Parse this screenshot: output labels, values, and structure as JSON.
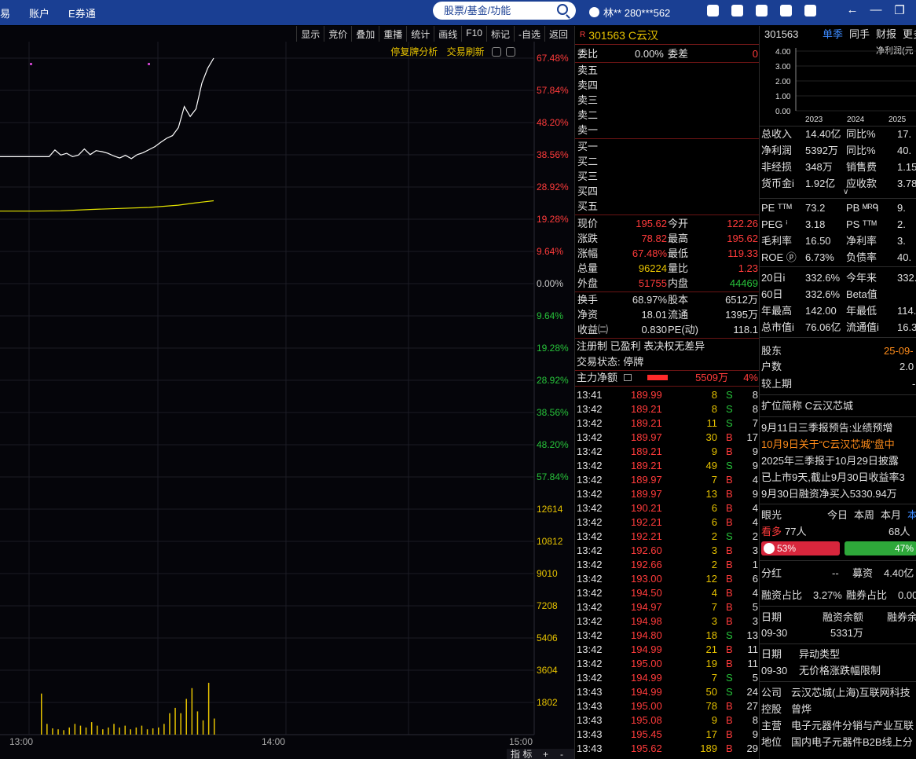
{
  "topbar": {
    "menu": [
      "易",
      "账户",
      "E券通"
    ],
    "search_placeholder": "股票/基金/功能",
    "user": "林**  280***562"
  },
  "chart": {
    "toolbar": [
      "显示",
      "竞价",
      "叠加",
      "重播",
      "统计",
      "画线",
      "F10",
      "标记",
      "-自选",
      "返回"
    ],
    "links": [
      "停复牌分析",
      "交易刷新"
    ],
    "pct_axis": [
      "67.48%",
      "57.84%",
      "48.20%",
      "38.56%",
      "28.92%",
      "19.28%",
      "9.64%",
      "0.00%",
      "9.64%",
      "19.28%",
      "28.92%",
      "38.56%",
      "48.20%",
      "57.84%"
    ],
    "vol_axis": [
      "12614",
      "10812",
      "9010",
      "7208",
      "5406",
      "3604",
      "1802"
    ],
    "time_axis": [
      "13:00",
      "14:00",
      "15:00"
    ],
    "bottom_tabs": [
      "指 标",
      "+",
      "-"
    ]
  },
  "quote": {
    "code": "301563 C云汉",
    "weibi": {
      "label": "委比",
      "value": "0.00%",
      "label2": "委差",
      "value2": "0"
    },
    "asks": [
      "卖五",
      "卖四",
      "卖三",
      "卖二",
      "卖一"
    ],
    "bids": [
      "买一",
      "买二",
      "买三",
      "买四",
      "买五"
    ],
    "stats": [
      {
        "l1": "现价",
        "v1": "195.62",
        "c1": "red",
        "l2": "今开",
        "v2": "122.26",
        "c2": "red"
      },
      {
        "l1": "涨跌",
        "v1": "78.82",
        "c1": "red",
        "l2": "最高",
        "v2": "195.62",
        "c2": "red"
      },
      {
        "l1": "涨幅",
        "v1": "67.48%",
        "c1": "red",
        "l2": "最低",
        "v2": "119.33",
        "c2": "red"
      },
      {
        "l1": "总量",
        "v1": "96224",
        "c1": "yellow",
        "l2": "量比",
        "v2": "1.23",
        "c2": "red"
      },
      {
        "l1": "外盘",
        "v1": "51755",
        "c1": "red",
        "l2": "内盘",
        "v2": "44469",
        "c2": "green"
      }
    ],
    "stats2": [
      {
        "l1": "换手",
        "v1": "68.97%",
        "l2": "股本",
        "v2": "6512万"
      },
      {
        "l1": "净资",
        "v1": "18.01",
        "l2": "流通",
        "v2": "1395万"
      },
      {
        "l1": "收益㈡",
        "v1": "0.830",
        "l2": "PE(动)",
        "v2": "118.1"
      }
    ],
    "tags": "注册制 已盈利 表决权无差异",
    "status": "交易状态: 停牌",
    "main_flow": {
      "label": "主力净额",
      "value": "5509万",
      "pct": "4%"
    },
    "ticks": [
      {
        "t": "13:41",
        "p": "189.99",
        "v": "8",
        "d": "S",
        "n": "8"
      },
      {
        "t": "13:42",
        "p": "189.21",
        "v": "8",
        "d": "S",
        "n": "8"
      },
      {
        "t": "13:42",
        "p": "189.21",
        "v": "11",
        "d": "S",
        "n": "7"
      },
      {
        "t": "13:42",
        "p": "189.97",
        "v": "30",
        "d": "B",
        "n": "17"
      },
      {
        "t": "13:42",
        "p": "189.21",
        "v": "9",
        "d": "B",
        "n": "9"
      },
      {
        "t": "13:42",
        "p": "189.21",
        "v": "49",
        "d": "S",
        "n": "9"
      },
      {
        "t": "13:42",
        "p": "189.97",
        "v": "7",
        "d": "B",
        "n": "4"
      },
      {
        "t": "13:42",
        "p": "189.97",
        "v": "13",
        "d": "B",
        "n": "9"
      },
      {
        "t": "13:42",
        "p": "190.21",
        "v": "6",
        "d": "B",
        "n": "4"
      },
      {
        "t": "13:42",
        "p": "192.21",
        "v": "6",
        "d": "B",
        "n": "4"
      },
      {
        "t": "13:42",
        "p": "192.21",
        "v": "2",
        "d": "S",
        "n": "2"
      },
      {
        "t": "13:42",
        "p": "192.60",
        "v": "3",
        "d": "B",
        "n": "3"
      },
      {
        "t": "13:42",
        "p": "192.66",
        "v": "2",
        "d": "B",
        "n": "1"
      },
      {
        "t": "13:42",
        "p": "193.00",
        "v": "12",
        "d": "B",
        "n": "6"
      },
      {
        "t": "13:42",
        "p": "194.50",
        "v": "4",
        "d": "B",
        "n": "4"
      },
      {
        "t": "13:42",
        "p": "194.97",
        "v": "7",
        "d": "B",
        "n": "5"
      },
      {
        "t": "13:42",
        "p": "194.98",
        "v": "3",
        "d": "B",
        "n": "3"
      },
      {
        "t": "13:42",
        "p": "194.80",
        "v": "18",
        "d": "S",
        "n": "13"
      },
      {
        "t": "13:42",
        "p": "194.99",
        "v": "21",
        "d": "B",
        "n": "11"
      },
      {
        "t": "13:42",
        "p": "195.00",
        "v": "19",
        "d": "B",
        "n": "11"
      },
      {
        "t": "13:42",
        "p": "194.99",
        "v": "7",
        "d": "S",
        "n": "5"
      },
      {
        "t": "13:43",
        "p": "194.99",
        "v": "50",
        "d": "S",
        "n": "24"
      },
      {
        "t": "13:43",
        "p": "195.00",
        "v": "78",
        "d": "B",
        "n": "27"
      },
      {
        "t": "13:43",
        "p": "195.08",
        "v": "9",
        "d": "B",
        "n": "8"
      },
      {
        "t": "13:43",
        "p": "195.45",
        "v": "17",
        "d": "B",
        "n": "9"
      },
      {
        "t": "13:43",
        "p": "195.62",
        "v": "189",
        "d": "B",
        "n": "29"
      }
    ]
  },
  "info": {
    "code": "301563",
    "tabs": [
      "单季",
      "同手",
      "财报",
      "更多"
    ],
    "chart_title": "净利润(元",
    "chart_y": [
      "4.00",
      "3.00",
      "2.00",
      "1.00",
      "0.00"
    ],
    "chart_x": [
      "2023",
      "2024",
      "2025"
    ],
    "fin": [
      {
        "l1": "总收入",
        "v1": "14.40亿",
        "l2": "同比%",
        "v2": "17."
      },
      {
        "l1": "净利润",
        "v1": "5392万",
        "l2": "同比%",
        "v2": "40."
      },
      {
        "l1": "非经损",
        "v1": "348万",
        "l2": "销售费",
        "v2": "1.15"
      },
      {
        "l1": "货币金i",
        "v1": "1.92亿",
        "l2": "应收款",
        "v2": "3.78"
      }
    ],
    "val": [
      {
        "l1": "PE ᵀᵀᴹ",
        "v1": "73.2",
        "l2": "PB ᴹᴿᑫ",
        "v2": "9."
      },
      {
        "l1": "PEG ⁱ",
        "v1": "3.18",
        "l2": "PS ᵀᵀᴹ",
        "v2": "2."
      },
      {
        "l1": "毛利率",
        "v1": "16.50",
        "l2": "净利率",
        "v2": "3."
      },
      {
        "l1": "ROE ⓟ",
        "v1": "6.73%",
        "l2": "负债率",
        "v2": "40."
      }
    ],
    "perf": [
      {
        "l1": "20日i",
        "v1": "332.6%",
        "l2": "今年来",
        "v2": "332.6"
      },
      {
        "l1": "60日",
        "v1": "332.6%",
        "l2": "Beta值",
        "v2": ""
      },
      {
        "l1": "年最高",
        "v1": "142.00",
        "l2": "年最低",
        "v2": "114."
      },
      {
        "l1": "总市值i",
        "v1": "76.06亿",
        "l2": "流通值i",
        "v2": "16.30"
      }
    ],
    "holders": {
      "label": "股东",
      "date": "25-09-",
      "count_label": "户数",
      "count": "2.0",
      "prev_label": "较上期",
      "prev": "-"
    },
    "short_name": "扩位简称  C云汉芯城",
    "news": [
      {
        "text": "9月11日三季报预告:业绩预增",
        "color": "white"
      },
      {
        "text": "10月9日关于“C云汉芯城”盘中",
        "color": "orange"
      },
      {
        "text": "2025年三季报于10月29日披露",
        "color": "white"
      },
      {
        "text": "已上市9天,截止9月30日收益率3",
        "color": "white"
      },
      {
        "text": "9月30日融资净买入5330.94万",
        "color": "white"
      }
    ],
    "vision": {
      "label": "眼光",
      "tabs": [
        "今日",
        "本周",
        "本月",
        "本"
      ],
      "bull_label": "看多",
      "bull_count": "77人",
      "bear_count": "68人",
      "bull_pct": "53%",
      "bear_pct": "47%",
      "bull_frac": 0.53
    },
    "dividend": {
      "l1": "分红",
      "v1": "--",
      "l2": "募资",
      "v2": "4.40亿"
    },
    "margin": {
      "l1": "融资占比",
      "v1": "3.27%",
      "l2": "融券占比",
      "v2": "0.00"
    },
    "margin_table": {
      "h1": "日期",
      "h2": "融资余额",
      "h3": "融券余",
      "d": "09-30",
      "v": "5331万"
    },
    "anomaly": {
      "h1": "日期",
      "h2": "异动类型",
      "d": "09-30",
      "v": "无价格涨跌幅限制"
    },
    "company": [
      {
        "l": "公司",
        "v": "云汉芯城(上海)互联网科技"
      },
      {
        "l": "控股",
        "v": "曾烨"
      },
      {
        "l": "主营",
        "v": "电子元器件分销与产业互联"
      },
      {
        "l": "地位",
        "v": "国内电子元器件B2B线上分"
      }
    ]
  },
  "chart_data": {
    "type": "line",
    "x_range": [
      "13:00",
      "15:00"
    ],
    "pct_range": [
      -57.84,
      67.48
    ],
    "price_pct_series": [
      [
        0,
        38.0
      ],
      [
        3,
        38.0
      ],
      [
        4,
        40.0
      ],
      [
        5,
        38.5
      ],
      [
        6,
        39.0
      ],
      [
        7,
        38.0
      ],
      [
        8,
        38.5
      ],
      [
        9,
        40.3
      ],
      [
        10,
        38.6
      ],
      [
        11,
        39.8
      ],
      [
        12,
        39.5
      ],
      [
        13,
        39.0
      ],
      [
        14,
        38.2
      ],
      [
        15,
        37.6
      ],
      [
        16,
        38.4
      ],
      [
        17,
        37.4
      ],
      [
        18,
        38.6
      ],
      [
        19,
        39.2
      ],
      [
        20,
        40.1
      ],
      [
        21,
        41.0
      ],
      [
        22,
        42.3
      ],
      [
        23,
        43.5
      ],
      [
        24,
        44.3
      ],
      [
        25,
        46.7
      ],
      [
        26,
        53.0
      ],
      [
        27,
        50.0
      ],
      [
        28,
        52.3
      ],
      [
        29,
        60.0
      ],
      [
        30,
        64.5
      ],
      [
        31,
        67.48
      ]
    ],
    "avg_pct_series": [
      [
        0,
        21.7
      ],
      [
        5,
        21.8
      ],
      [
        10,
        22.2
      ],
      [
        15,
        22.5
      ],
      [
        20,
        22.8
      ],
      [
        25,
        23.5
      ],
      [
        28,
        24.2
      ],
      [
        31,
        24.8
      ]
    ],
    "volume_series": [
      [
        0,
        2300
      ],
      [
        1,
        600
      ],
      [
        2,
        350
      ],
      [
        3,
        300
      ],
      [
        4,
        250
      ],
      [
        5,
        400
      ],
      [
        6,
        600
      ],
      [
        7,
        500
      ],
      [
        8,
        400
      ],
      [
        9,
        700
      ],
      [
        10,
        500
      ],
      [
        11,
        300
      ],
      [
        12,
        400
      ],
      [
        13,
        600
      ],
      [
        14,
        400
      ],
      [
        15,
        500
      ],
      [
        16,
        300
      ],
      [
        17,
        400
      ],
      [
        18,
        500
      ],
      [
        19,
        300
      ],
      [
        20,
        350
      ],
      [
        21,
        400
      ],
      [
        22,
        600
      ],
      [
        23,
        1200
      ],
      [
        24,
        1500
      ],
      [
        25,
        1200
      ],
      [
        26,
        2000
      ],
      [
        27,
        2600
      ],
      [
        28,
        1300
      ],
      [
        29,
        800
      ],
      [
        30,
        2900
      ],
      [
        31,
        900
      ]
    ],
    "vol_max": 12614
  }
}
